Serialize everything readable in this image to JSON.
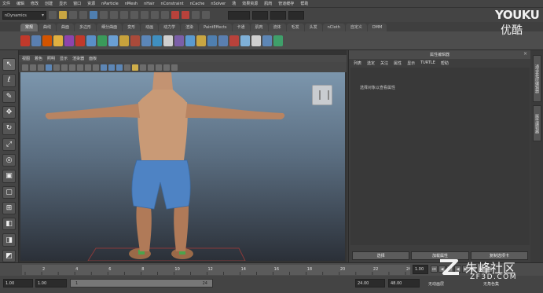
{
  "menubar": [
    "文件",
    "编辑",
    "修改",
    "创建",
    "显示",
    "窗口",
    "资源",
    "nParticle",
    "nMesh",
    "nHair",
    "nConstraint",
    "nCache",
    "nSolver",
    "场",
    "效果资源",
    "肌肉",
    "管道缓存",
    "帮助"
  ],
  "status_line": {
    "mode": "nDynamics"
  },
  "shelf_tabs": [
    {
      "label": "常规",
      "active": true
    },
    {
      "label": "曲线",
      "active": false
    },
    {
      "label": "曲面",
      "active": false
    },
    {
      "label": "多边形",
      "active": false
    },
    {
      "label": "细分曲面",
      "active": false
    },
    {
      "label": "变形",
      "active": false
    },
    {
      "label": "动画",
      "active": false
    },
    {
      "label": "动力学",
      "active": false
    },
    {
      "label": "渲染",
      "active": false
    },
    {
      "label": "PaintEffects",
      "active": false
    },
    {
      "label": "卡通",
      "active": false
    },
    {
      "label": "肌肉",
      "active": false
    },
    {
      "label": "流体",
      "active": false
    },
    {
      "label": "毛发",
      "active": false
    },
    {
      "label": "头发",
      "active": false
    },
    {
      "label": "nCloth",
      "active": false
    },
    {
      "label": "自定义",
      "active": false
    },
    {
      "label": "DMM",
      "active": false
    }
  ],
  "shelf_icon_colors": [
    "#c0392b",
    "#5a7fb0",
    "#d35400",
    "#e0b040",
    "#8e44ad",
    "#c0392b",
    "#5a8fc8",
    "#3a9a5a",
    "#6a9fd4",
    "#c7a23c",
    "#aa4a3a",
    "#5b86b8",
    "#3f8fc0",
    "#d0d0d0",
    "#7b5fa8",
    "#5a9ad0",
    "#c9a642",
    "#4f7fb0",
    "#5a7fb0",
    "#b8423b",
    "#7fb0d8",
    "#cfcfcf",
    "#5d86b5",
    "#3f9f6a"
  ],
  "viewport": {
    "menu": [
      "视图",
      "着色",
      "照明",
      "显示",
      "渲染器",
      "面板"
    ],
    "background_top": "#7c96ad",
    "background_bottom": "#2b3038"
  },
  "attribute_editor": {
    "title": "属性编辑器",
    "menu": [
      "列表",
      "选定",
      "关注",
      "属性",
      "显示",
      "TURTLE",
      "帮助"
    ],
    "hint": "选择对象以查看属性",
    "buttons": [
      "选择",
      "加载属性",
      "复制选项卡"
    ]
  },
  "right_tabs": [
    "通道盒/层编辑器",
    "属性编辑器"
  ],
  "time_slider": {
    "ticks": [
      "2",
      "4",
      "6",
      "8",
      "10",
      "12",
      "14",
      "16",
      "18",
      "20",
      "22",
      "24"
    ],
    "current": "1.00"
  },
  "range_slider": {
    "start": "1.00",
    "anim_start": "1.00",
    "range_in": "1",
    "range_out": "24",
    "end": "24.00",
    "anim_end": "48.00",
    "anim_layer": "无动画层",
    "char_set": "无角色集"
  },
  "watermarks": {
    "youku_en": "YOUKU",
    "youku_cn": "优酷",
    "zf3d_cn": "朱峰社区",
    "zf3d_url": "ZF3D.COM"
  }
}
